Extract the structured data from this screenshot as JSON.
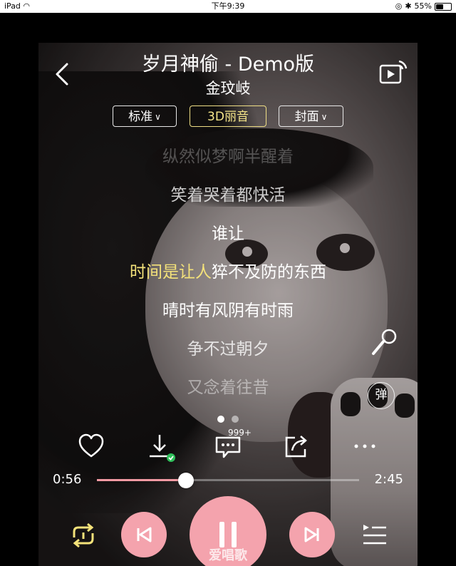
{
  "status_bar": {
    "device": "iPad",
    "time": "下午9:39",
    "battery": "55%",
    "battery_level": 0.55
  },
  "header": {
    "title": "岁月神偷 - Demo版",
    "artist": "金玟岐",
    "back_icon": "chevron-left-icon",
    "cast_icon": "cast-screen-icon"
  },
  "modes": {
    "quality": "标准",
    "sound": "3D丽音",
    "view": "封面",
    "active": "3D丽音"
  },
  "lyrics": {
    "lines": [
      "纵然似梦啊半醒着",
      "笑着哭着都快活",
      "谁让"
    ],
    "current_sung": "时间是让人",
    "current_rest": "猝不及防的东西",
    "after": [
      "晴时有风阴有时雨",
      "争不过朝夕",
      "又念着往昔"
    ]
  },
  "side_buttons": {
    "mic_icon": "microphone-icon",
    "danmu_label": "弹"
  },
  "pager": {
    "pages": 2,
    "current": 1
  },
  "actions": {
    "like_icon": "heart-icon",
    "download_icon": "download-icon",
    "comment_icon": "comment-icon",
    "comment_count": "999+",
    "share_icon": "share-icon",
    "more_icon": "more-icon"
  },
  "progress": {
    "current": "0:56",
    "total": "2:45",
    "fraction": 0.34
  },
  "controls": {
    "repeat_icon": "repeat-one-icon",
    "prev_icon": "previous-icon",
    "pause_icon": "pause-icon",
    "next_icon": "next-icon",
    "playlist_icon": "playlist-icon"
  },
  "colors": {
    "accent_pink": "#f4a3ad",
    "highlight_yellow": "#f4e27a"
  },
  "watermark": "爱唱歌"
}
